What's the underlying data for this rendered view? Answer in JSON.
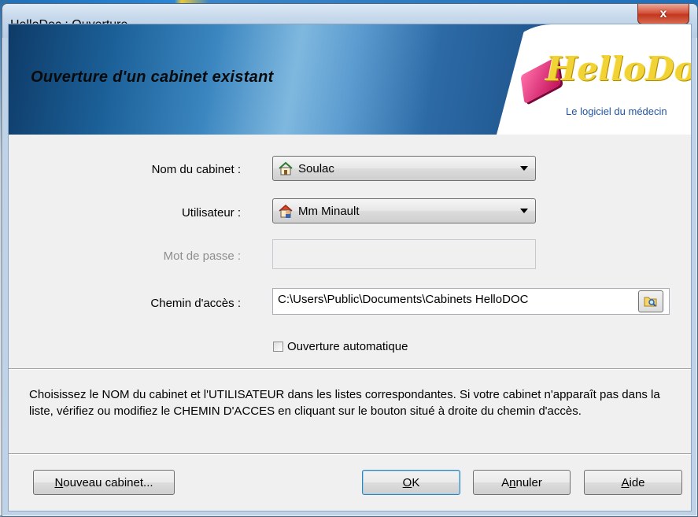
{
  "window": {
    "title": "HelloDoc : Ouverture",
    "close_glyph": "x"
  },
  "banner": {
    "title": "Ouverture d'un cabinet existant",
    "logo_text": "HelloDoc",
    "logo_tagline": "Le logiciel du médecin"
  },
  "form": {
    "cabinet_label": "Nom du cabinet :",
    "cabinet_value": "Soulac",
    "user_label": "Utilisateur :",
    "user_value": "Mm Minault",
    "password_label": "Mot de passe :",
    "password_value": "",
    "path_label": "Chemin d'accès :",
    "path_value": "C:\\Users\\Public\\Documents\\Cabinets HelloDOC",
    "auto_open_label": "Ouverture automatique",
    "auto_open_checked": false
  },
  "help": {
    "text": "Choisissez le NOM du cabinet et l'UTILISATEUR dans les listes correspondantes. Si votre cabinet n'apparaît pas dans la liste, vérifiez ou modifiez le CHEMIN D'ACCES en cliquant sur le bouton situé à droite du chemin d'accès."
  },
  "buttons": {
    "new_cabinet": {
      "mnemonic": "N",
      "rest": "ouveau cabinet..."
    },
    "ok": {
      "mnemonic": "O",
      "rest": "K"
    },
    "cancel": {
      "pre": "A",
      "mnemonic": "n",
      "rest": "nuler"
    },
    "help": {
      "mnemonic": "A",
      "rest": "ide"
    }
  },
  "colors": {
    "banner_dark": "#0e3b68",
    "banner_light": "#7fb8df",
    "logo_yellow": "#f2d335",
    "logo_pink": "#c3105b",
    "close_red": "#c2371f"
  },
  "icons": {
    "cabinet": "house-icon",
    "user": "house-user-icon",
    "browse": "folder-search-icon"
  }
}
